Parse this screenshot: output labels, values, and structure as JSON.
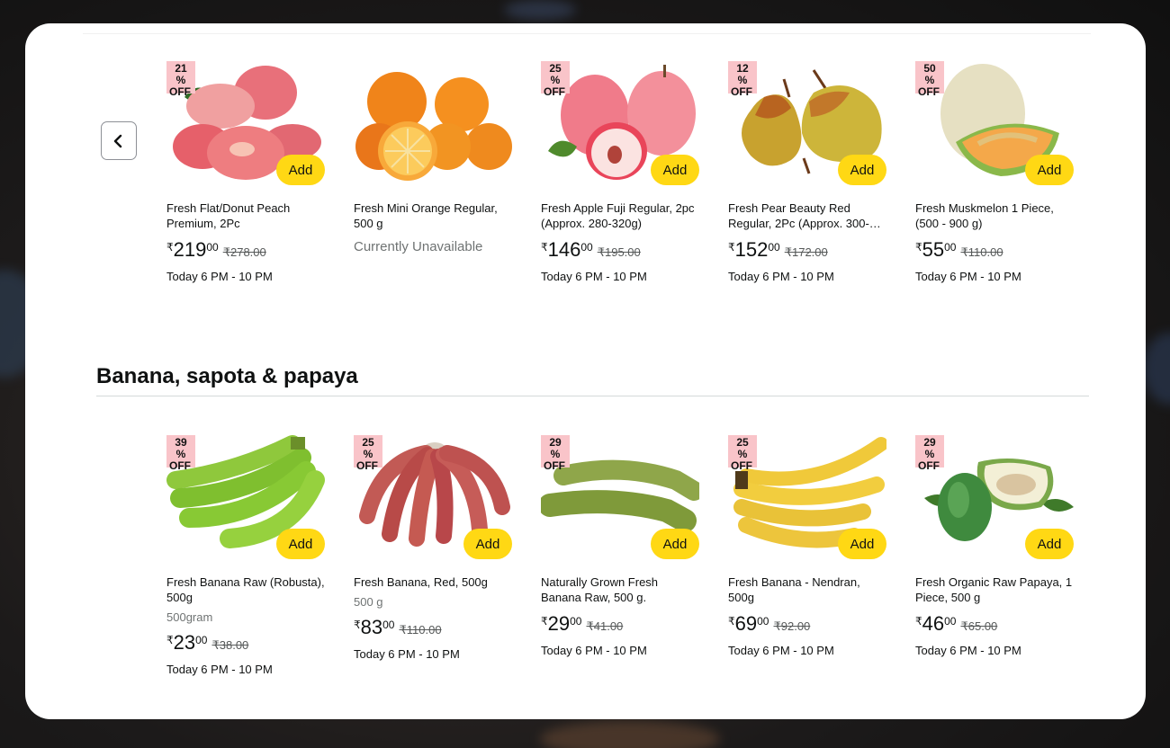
{
  "nav": {
    "prev_icon": "chevron-left-icon"
  },
  "section": {
    "title": "Banana, sapota & papaya"
  },
  "add_label": "Add",
  "badge_off_label": "OFF",
  "badge_percent": "%",
  "currency_symbol": "₹",
  "row1": [
    {
      "name": "Fresh Flat/Donut Peach Premium, 2Pc",
      "discount": "21",
      "price_whole": "219",
      "price_frac": "00",
      "mrp": "₹278.00",
      "delivery": "Today 6 PM - 10 PM",
      "image": "peach"
    },
    {
      "name": "Fresh Mini Orange Regular, 500 g",
      "discount": "",
      "unavailable": "Currently Unavailable",
      "image": "orange"
    },
    {
      "name": "Fresh Apple Fuji Regular, 2pc (Approx. 280-320g)",
      "discount": "25",
      "price_whole": "146",
      "price_frac": "00",
      "mrp": "₹195.00",
      "delivery": "Today 6 PM - 10 PM",
      "image": "apple"
    },
    {
      "name": "Fresh Pear Beauty Red Regular, 2Pc (Approx. 300-…",
      "discount": "12",
      "price_whole": "152",
      "price_frac": "00",
      "mrp": "₹172.00",
      "delivery": "Today 6 PM - 10 PM",
      "image": "pear"
    },
    {
      "name": "Fresh Muskmelon 1 Piece, (500 - 900 g)",
      "discount": "50",
      "price_whole": "55",
      "price_frac": "00",
      "mrp": "₹110.00",
      "delivery": "Today 6 PM - 10 PM",
      "image": "muskmelon"
    }
  ],
  "row2": [
    {
      "name": "Fresh Banana Raw (Robusta), 500g",
      "discount": "39",
      "size": "500gram",
      "price_whole": "23",
      "price_frac": "00",
      "mrp": "₹38.00",
      "delivery": "Today 6 PM - 10 PM",
      "image": "green-banana"
    },
    {
      "name": "Fresh Banana, Red, 500g",
      "discount": "25",
      "size": "500 g",
      "price_whole": "83",
      "price_frac": "00",
      "mrp": "₹110.00",
      "delivery": "Today 6 PM - 10 PM",
      "image": "red-banana"
    },
    {
      "name": "Naturally Grown Fresh Banana Raw, 500 g.",
      "discount": "29",
      "price_whole": "29",
      "price_frac": "00",
      "mrp": "₹41.00",
      "delivery": "Today 6 PM - 10 PM",
      "image": "raw-banana"
    },
    {
      "name": "Fresh Banana - Nendran, 500g",
      "discount": "25",
      "price_whole": "69",
      "price_frac": "00",
      "mrp": "₹92.00",
      "delivery": "Today 6 PM - 10 PM",
      "image": "yellow-banana"
    },
    {
      "name": "Fresh Organic Raw Papaya, 1 Piece, 500 g",
      "discount": "29",
      "price_whole": "46",
      "price_frac": "00",
      "mrp": "₹65.00",
      "delivery": "Today 6 PM - 10 PM",
      "image": "papaya"
    }
  ],
  "colors": {
    "add_button": "#ffd814",
    "badge": "#f9c4c9",
    "text": "#0f1111",
    "muted": "#6f7373"
  }
}
